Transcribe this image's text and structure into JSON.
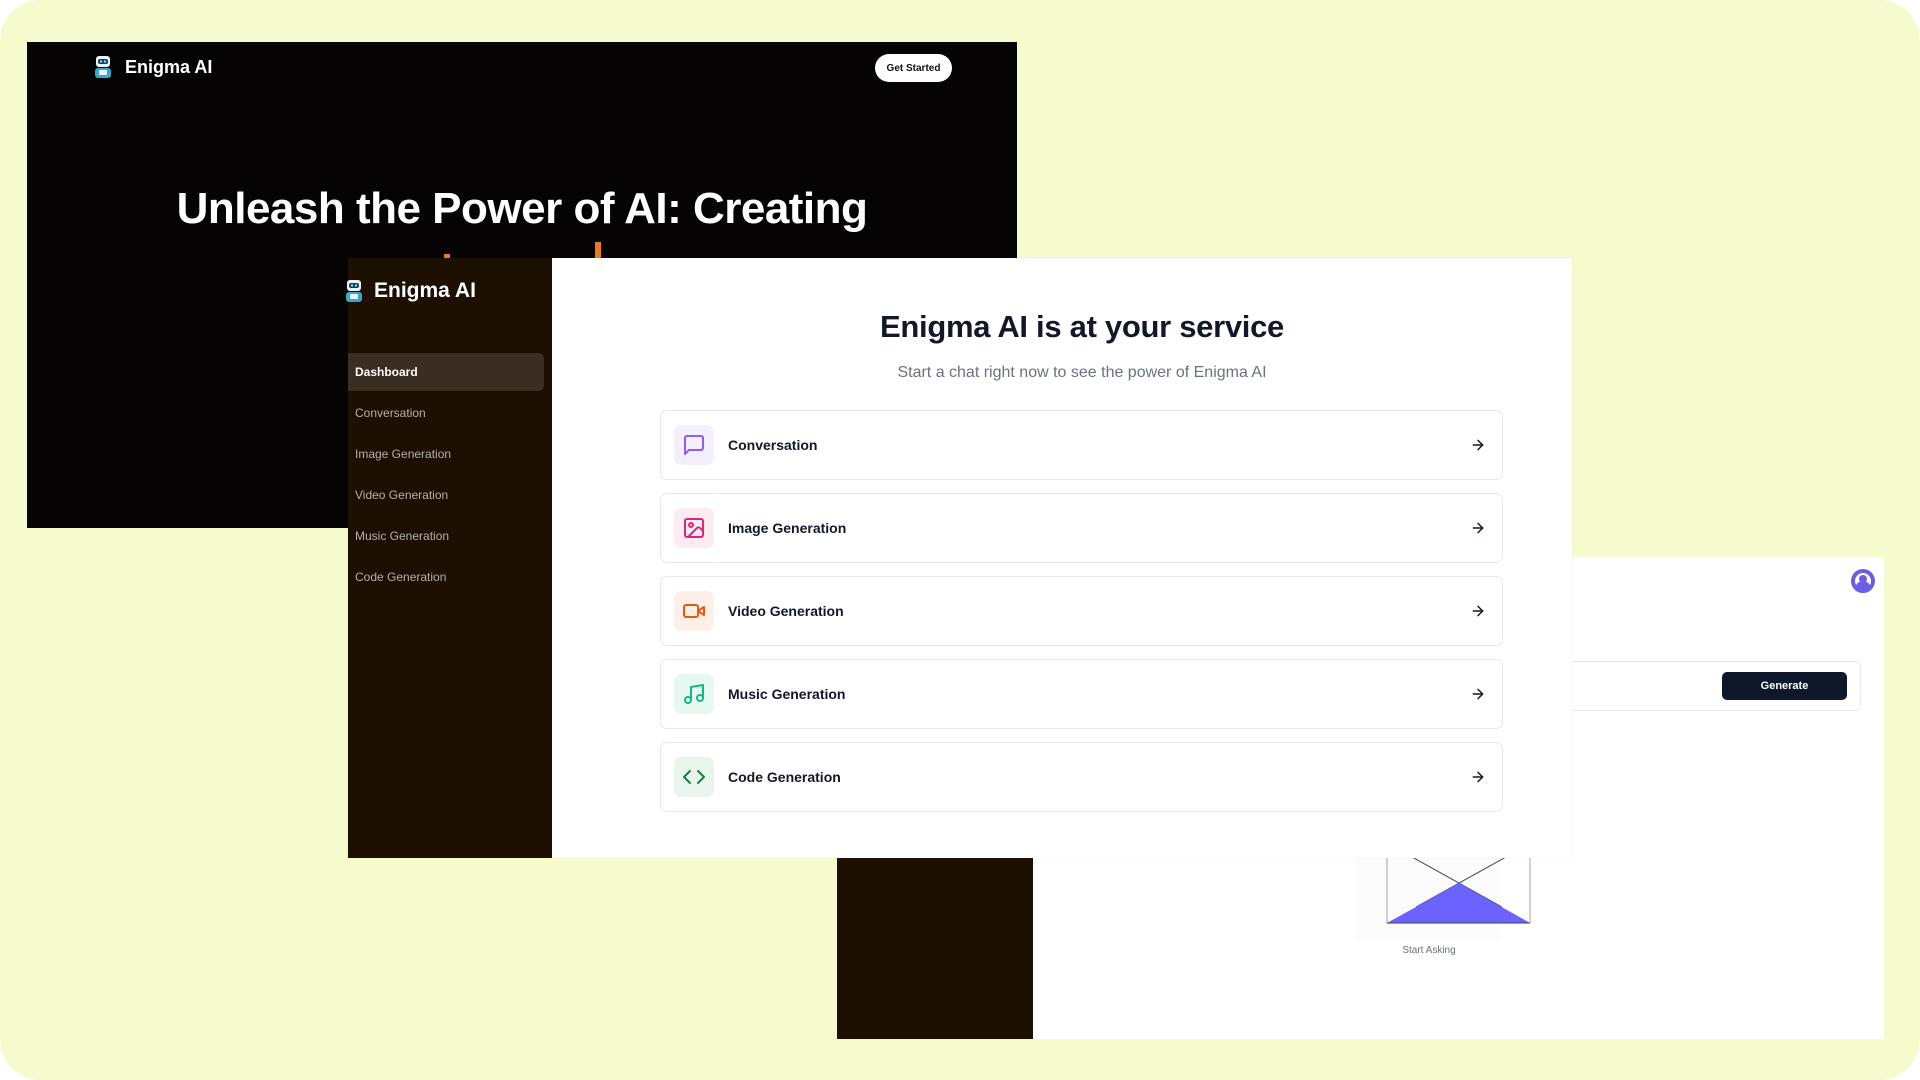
{
  "landing": {
    "brand": "Enigma AI",
    "cta_label": "Get Started",
    "hero": "Unleash the Power of AI: Creating",
    "hero_accent_color": "#ea7a1a"
  },
  "dashboard": {
    "brand": "Enigma AI",
    "nav": [
      {
        "label": "Dashboard",
        "active": true
      },
      {
        "label": "Conversation"
      },
      {
        "label": "Image Generation"
      },
      {
        "label": "Video Generation"
      },
      {
        "label": "Music Generation"
      },
      {
        "label": "Code Generation"
      }
    ],
    "title": "Enigma AI is at your service",
    "subtitle": "Start a chat right now to see the power of Enigma AI",
    "tools": [
      {
        "label": "Conversation",
        "icon": "message-square-icon",
        "color": "#8b5cf6",
        "bg": "#f3effe"
      },
      {
        "label": "Image Generation",
        "icon": "image-icon",
        "color": "#db2777",
        "bg": "#fcecf2"
      },
      {
        "label": "Video Generation",
        "icon": "video-icon",
        "color": "#ea580c",
        "bg": "#fdf0e8"
      },
      {
        "label": "Music Generation",
        "icon": "music-icon",
        "color": "#10b981",
        "bg": "#e7f8f1"
      },
      {
        "label": "Code Generation",
        "icon": "code-icon",
        "color": "#15803d",
        "bg": "#e8f4ec"
      }
    ]
  },
  "generation": {
    "generate_label": "Generate",
    "empty_label": "Start Asking",
    "accent_color": "#6c5ce7"
  },
  "colors": {
    "background": "#f5fbcd",
    "sidebar": "#1e0f03",
    "landing_bg": "#050303",
    "button_dark": "#0f172a"
  }
}
